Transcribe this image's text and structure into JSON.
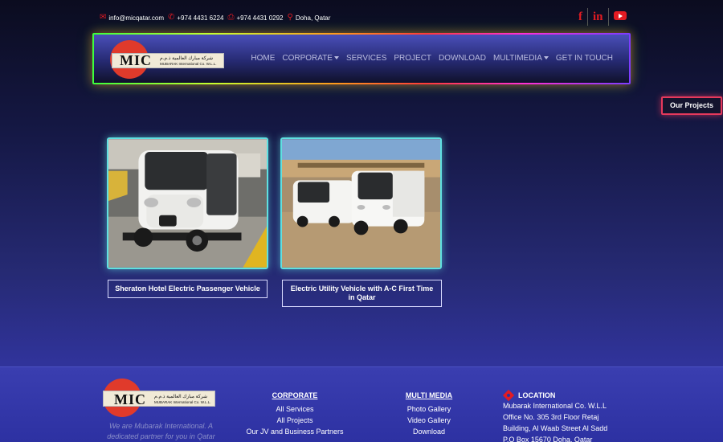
{
  "topbar": {
    "email": "info@micqatar.com",
    "phone": "+974 4431 6224",
    "fax": "+974 4431 0292",
    "location": "Doha, Qatar"
  },
  "social": [
    "f",
    "in",
    "youtube-icon"
  ],
  "logo": {
    "mark": "MIC",
    "arabic": "شركة مبارك العالمية ذ.م.م",
    "english": "MUBARAK International Co. W.L.L."
  },
  "nav": {
    "items": [
      "HOME",
      "CORPORATE",
      "SERVICES",
      "PROJECT",
      "DOWNLOAD",
      "MULTIMEDIA",
      "GET IN TOUCH"
    ],
    "dropdowns": [
      "CORPORATE",
      "MULTIMEDIA"
    ]
  },
  "badge": "Our Projects",
  "projects": [
    {
      "caption": "Sheraton Hotel Electric Passenger Vehicle"
    },
    {
      "caption": "Electric Utility Vehicle with A-C First Time in Qatar"
    }
  ],
  "footer": {
    "tagline": "We are Mubarak International. A dedicated partner for you in Qatar",
    "corporate": {
      "title": "CORPORATE",
      "links": [
        "All Services",
        "All Projects",
        "Our JV and Business Partners"
      ]
    },
    "multimedia": {
      "title": "MULTI MEDIA",
      "links": [
        "Photo Gallery",
        "Video Gallery",
        "Download"
      ]
    },
    "location": {
      "title": "LOCATION",
      "lines": [
        "Mubarak International Co. W.L.L",
        "Office No. 305 3rd Floor Retaj",
        "Building, Al Waab Street Al Sadd",
        "P.O Box 15670 Doha, Qatar"
      ]
    }
  },
  "colors": {
    "accent": "#e31b23",
    "neon_cyan": "#5fe0e0",
    "badge_border": "#e6395c"
  }
}
